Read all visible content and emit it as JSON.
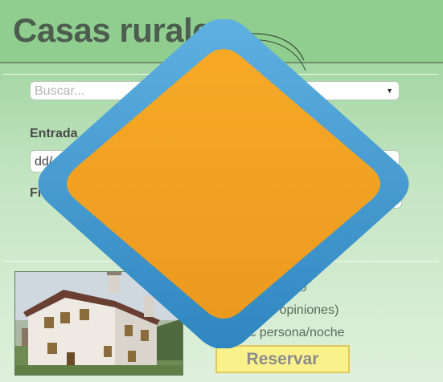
{
  "header": {
    "title": "Casas rurales"
  },
  "search": {
    "placeholder": "Buscar...",
    "dropdown_icon": "caret-down-icon"
  },
  "dates": {
    "entrada_label": "Entrada",
    "entrada_value": "dd/",
    "fin_label": "Fi"
  },
  "listing": {
    "name_fragment": "ncisco",
    "opinions_fragment": "(90 opiniones)",
    "price_fragment": "0 € persona/noche",
    "reserve_label": "Reservar"
  },
  "overlay": {
    "icon": "orange-diamond-icon"
  },
  "colors": {
    "header_bg": "#8fce8e",
    "title_text": "#4d5d50",
    "reserve_bg": "#fbf18a",
    "diamond_fill": "#f2a224",
    "diamond_border": "#3f95cc"
  }
}
